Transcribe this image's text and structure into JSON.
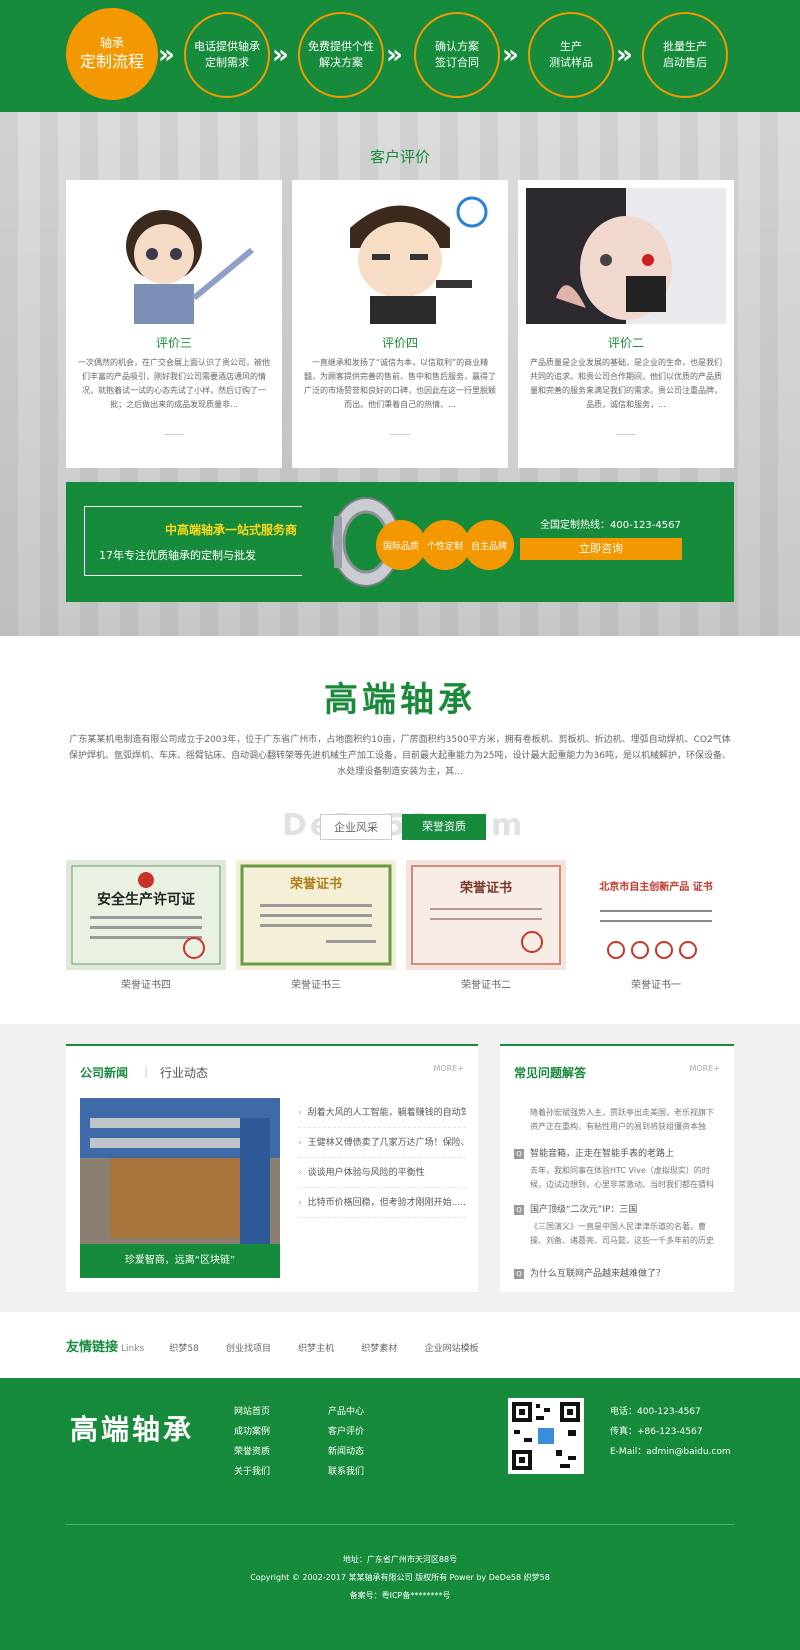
{
  "process": {
    "steps": [
      {
        "line1": "轴承",
        "line2": "定制流程"
      },
      {
        "line1": "电话提供轴承",
        "line2": "定制需求"
      },
      {
        "line1": "免费提供个性",
        "line2": "解决方案"
      },
      {
        "line1": "确认方案",
        "line2": "签订合同"
      },
      {
        "line1": "生产",
        "line2": "测试样品"
      },
      {
        "line1": "批量生产",
        "line2": "启动售后"
      }
    ],
    "arrow": "»"
  },
  "reviews": {
    "title": "客户评价",
    "cards": [
      {
        "name": "评价三",
        "desc": "一次偶然的机会，在广交会展上面认识了贵公司，被他们丰富的产品吸引，刚好我们公司需要酒店通风的情况，就抱着试一试的心态先试了小样，然后订购了一批；之后做出来的成品发现质量非..."
      },
      {
        "name": "评价四",
        "desc": "一直继承和发扬了“诚信为本，以信取利”的商业精髓，为顾客提供完善的售前、售中和售后服务，赢得了广泛的市场赞誉和良好的口碑，也因此在这一行里脱颖而出。他们秉着自己的热情、..."
      },
      {
        "name": "评价二",
        "desc": "产品质量是企业发展的基础，是企业的生命，也是我们共同的追求。和贵公司合作期间，他们以优质的产品质量和完善的服务来满足我们的需求。贵公司注重品牌，品质，诚信和服务，..."
      }
    ]
  },
  "banner": {
    "headline": "中高端轴承一站式服务商",
    "sub": "17年专注优质轴承的定制与批发",
    "pills": [
      "国际品质",
      "个性定制",
      "自主品牌"
    ],
    "hotline": "全国定制热线：400-123-4567",
    "consult": "立即咨询"
  },
  "about": {
    "logo": "高端轴承",
    "text": "广东某某机电制造有限公司成立于2003年，位于广东省广州市，占地面积约10亩，厂房面积约3500平方米，拥有卷板机、剪板机、折边机、埋弧自动焊机、CO2气体保护焊机、氩弧焊机、车床、摇臂钻床、自动调心翻转架等先进机械生产加工设备，目前最大起重能力为25吨，设计最大起重能力为36吨，是以机械解护，环保设备、水处理设备制造安装为主，其...",
    "tabs": [
      "企业风采",
      "荣誉资质"
    ],
    "watermark": "DeDe58.com"
  },
  "certs": [
    {
      "caption": "荣誉证书四",
      "title": "安全生产许可证"
    },
    {
      "caption": "荣誉证书三",
      "title": "荣誉证书"
    },
    {
      "caption": "荣誉证书二",
      "title": "荣誉证书"
    },
    {
      "caption": "荣誉证书一",
      "title": "北京市自主创新产品 证书"
    }
  ],
  "news": {
    "tab_active": "公司新闻",
    "tab_other": "行业动态",
    "more": "MORE+",
    "image_caption": "珍爱智商，远离“区块链”",
    "items": [
      "刮着大风的人工智能，躺着赚钱的自动驾驶 |...",
      "王健林又傅债卖了几家万达广场！保险、信托...",
      "谈谈用户体验与风险的平衡性",
      "比特币价格回稳，但考验才刚刚开始......"
    ]
  },
  "faq": {
    "title": "常见问题解答",
    "more": "MORE+",
    "items": [
      {
        "q": "",
        "a": "随着孙宏斌强势入主，贾跃亭出走美国，老乐视旗下资产正在重构，有粘性用户的易到将获组僵资本独"
      },
      {
        "q": "智能音箱，正走在智能手表的老路上",
        "a": "去年，我和同事在体验HTC Vive（虚拟现实）的时候，边试边想到，心里非常激动。当时我们都在猜科技"
      },
      {
        "q": "国产顶级“二次元”IP：三国",
        "a": "《三国演义》一直是中国人民津津乐道的名著。曹操、刘备、诸葛亮、司马懿，这些一千多年前的历史"
      },
      {
        "q": "为什么互联网产品越来越难做了？",
        "a": ""
      }
    ]
  },
  "links": {
    "title": "友情链接",
    "sub": "Links",
    "items": [
      "织梦58",
      "创业找项目",
      "织梦主机",
      "织梦素材",
      "企业网站模板"
    ]
  },
  "footer": {
    "logo": "高端轴承",
    "nav_col1": [
      "网站首页",
      "成功案例",
      "荣誉资质",
      "关于我们"
    ],
    "nav_col2": [
      "产品中心",
      "客户评价",
      "新闻动态",
      "联系我们"
    ],
    "phone": "电话：400-123-4567",
    "fax": "传真：+86-123-4567",
    "email": "E-Mail：admin@baidu.com",
    "address": "地址：广东省广州市天河区88号",
    "copyright": "Copyright © 2002-2017 某某轴承有限公司 版权所有 Power by DeDe58   织梦58",
    "icp": "备案号：粤ICP备********号"
  },
  "colors": {
    "brand_green": "#178b3c",
    "accent_orange": "#f39800"
  }
}
